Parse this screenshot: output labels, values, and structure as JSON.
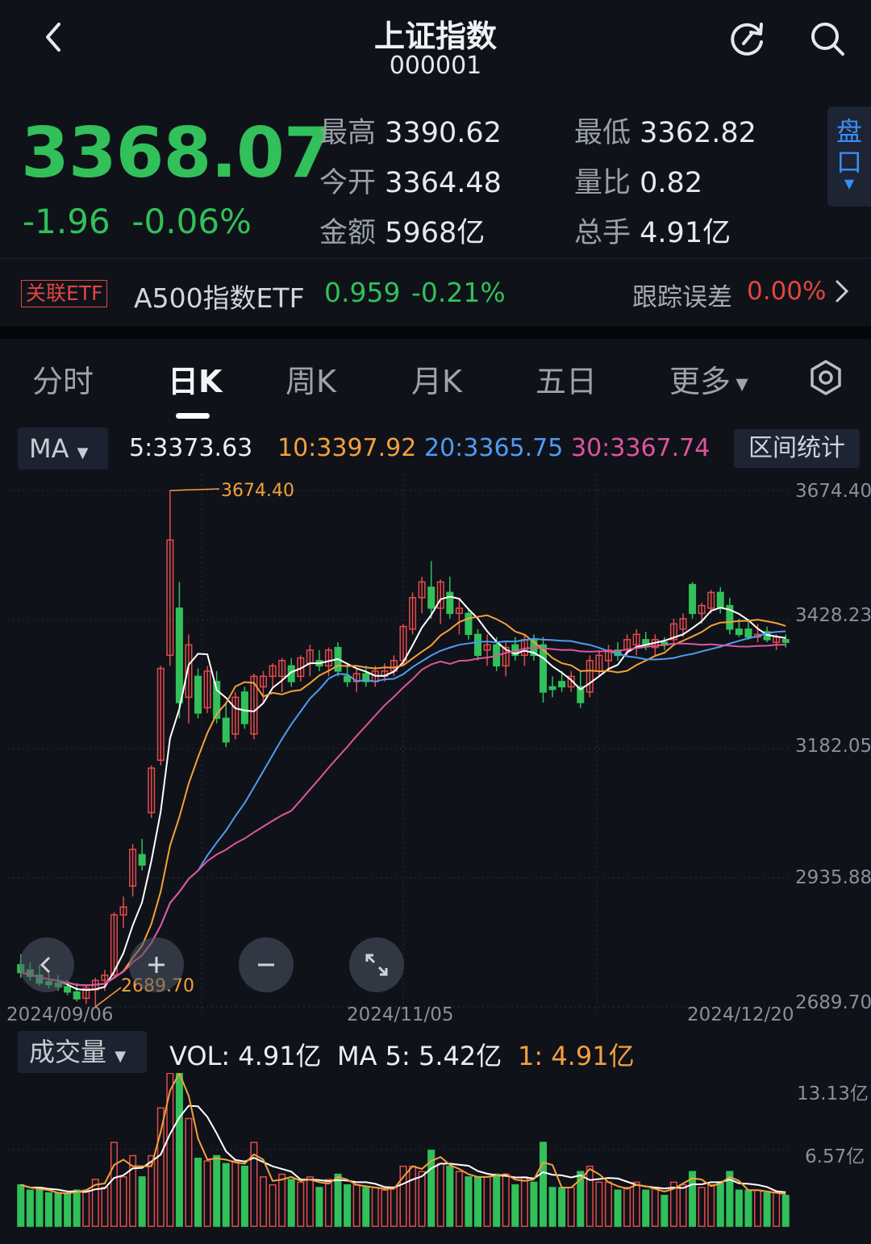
{
  "header": {
    "title": "上证指数",
    "code": "000001"
  },
  "quote": {
    "price": "3368.07",
    "change": "-1.96",
    "change_pct": "-0.06%",
    "high_label": "最高",
    "high": "3390.62",
    "low_label": "最低",
    "low": "3362.82",
    "open_label": "今开",
    "open": "3364.48",
    "vol_ratio_label": "量比",
    "vol_ratio": "0.82",
    "amount_label": "金额",
    "amount": "5968亿",
    "turnover_label": "总手",
    "turnover": "4.91亿",
    "pankou_label": "盘口"
  },
  "etf": {
    "tag": "关联ETF",
    "name": "A500指数ETF",
    "price": "0.959",
    "change_pct": "-0.21%",
    "tracking_label": "跟踪误差",
    "tracking_value": "0.00%"
  },
  "tabs": [
    "分时",
    "日K",
    "周K",
    "月K",
    "五日",
    "更多"
  ],
  "active_tab": 1,
  "ma_bar": {
    "selector": "MA",
    "ma5": "5:3373.63",
    "ma10": "10:3397.92",
    "ma20": "20:3365.75",
    "ma30": "30:3367.74",
    "range_button": "区间统计"
  },
  "price_axis": [
    "3674.40",
    "3428.23",
    "3182.05",
    "2935.88",
    "2689.70"
  ],
  "date_axis": [
    "2024/09/06",
    "2024/11/05",
    "2024/12/20"
  ],
  "annotations": {
    "max": "3674.40",
    "min": "2689.70"
  },
  "volume_bar": {
    "selector": "成交量",
    "vol": "VOL: 4.91亿",
    "ma5": "MA 5: 5.42亿",
    "ma1": "1: 4.91亿"
  },
  "volume_axis": [
    "13.13亿",
    "6.57亿"
  ],
  "colors": {
    "up": "#e54b4b",
    "down": "#31c05a",
    "ma5": "#ffffff",
    "ma10": "#f5a03c",
    "ma20": "#4f9cf2",
    "ma30": "#e0549e",
    "accent": "#3b8cf6"
  },
  "chart_data": {
    "type": "candlestick",
    "ylim": [
      2689.7,
      3674.4
    ],
    "candles": [
      {
        "o": 2770,
        "h": 2790,
        "l": 2745,
        "c": 2755
      },
      {
        "o": 2760,
        "h": 2775,
        "l": 2740,
        "c": 2748
      },
      {
        "o": 2750,
        "h": 2770,
        "l": 2730,
        "c": 2735
      },
      {
        "o": 2738,
        "h": 2755,
        "l": 2725,
        "c": 2732
      },
      {
        "o": 2735,
        "h": 2750,
        "l": 2720,
        "c": 2728
      },
      {
        "o": 2728,
        "h": 2740,
        "l": 2712,
        "c": 2718
      },
      {
        "o": 2718,
        "h": 2735,
        "l": 2700,
        "c": 2705
      },
      {
        "o": 2706,
        "h": 2730,
        "l": 2695,
        "c": 2725
      },
      {
        "o": 2722,
        "h": 2745,
        "l": 2689.7,
        "c": 2740
      },
      {
        "o": 2740,
        "h": 2760,
        "l": 2720,
        "c": 2750
      },
      {
        "o": 2750,
        "h": 2870,
        "l": 2745,
        "c": 2865
      },
      {
        "o": 2865,
        "h": 2900,
        "l": 2840,
        "c": 2880
      },
      {
        "o": 2920,
        "h": 3000,
        "l": 2900,
        "c": 2990
      },
      {
        "o": 2980,
        "h": 3010,
        "l": 2950,
        "c": 2960
      },
      {
        "o": 3060,
        "h": 3150,
        "l": 3050,
        "c": 3145
      },
      {
        "o": 3160,
        "h": 3340,
        "l": 3150,
        "c": 3335
      },
      {
        "o": 3360,
        "h": 3674.4,
        "l": 3340,
        "c": 3580
      },
      {
        "o": 3450,
        "h": 3500,
        "l": 3240,
        "c": 3270
      },
      {
        "o": 3280,
        "h": 3400,
        "l": 3230,
        "c": 3380
      },
      {
        "o": 3320,
        "h": 3335,
        "l": 3240,
        "c": 3250
      },
      {
        "o": 3260,
        "h": 3340,
        "l": 3250,
        "c": 3330
      },
      {
        "o": 3310,
        "h": 3330,
        "l": 3230,
        "c": 3240
      },
      {
        "o": 3240,
        "h": 3270,
        "l": 3185,
        "c": 3195
      },
      {
        "o": 3210,
        "h": 3290,
        "l": 3200,
        "c": 3280
      },
      {
        "o": 3290,
        "h": 3300,
        "l": 3220,
        "c": 3230
      },
      {
        "o": 3210,
        "h": 3325,
        "l": 3200,
        "c": 3320
      },
      {
        "o": 3300,
        "h": 3330,
        "l": 3270,
        "c": 3320
      },
      {
        "o": 3320,
        "h": 3345,
        "l": 3300,
        "c": 3340
      },
      {
        "o": 3320,
        "h": 3355,
        "l": 3290,
        "c": 3350
      },
      {
        "o": 3340,
        "h": 3355,
        "l": 3300,
        "c": 3310
      },
      {
        "o": 3320,
        "h": 3360,
        "l": 3310,
        "c": 3355
      },
      {
        "o": 3345,
        "h": 3380,
        "l": 3320,
        "c": 3370
      },
      {
        "o": 3350,
        "h": 3370,
        "l": 3330,
        "c": 3340
      },
      {
        "o": 3340,
        "h": 3375,
        "l": 3320,
        "c": 3370
      },
      {
        "o": 3375,
        "h": 3385,
        "l": 3320,
        "c": 3330
      },
      {
        "o": 3320,
        "h": 3345,
        "l": 3300,
        "c": 3310
      },
      {
        "o": 3310,
        "h": 3335,
        "l": 3290,
        "c": 3325
      },
      {
        "o": 3325,
        "h": 3340,
        "l": 3300,
        "c": 3310
      },
      {
        "o": 3310,
        "h": 3340,
        "l": 3300,
        "c": 3330
      },
      {
        "o": 3320,
        "h": 3345,
        "l": 3310,
        "c": 3330
      },
      {
        "o": 3330,
        "h": 3360,
        "l": 3320,
        "c": 3350
      },
      {
        "o": 3350,
        "h": 3420,
        "l": 3340,
        "c": 3415
      },
      {
        "o": 3410,
        "h": 3480,
        "l": 3400,
        "c": 3470
      },
      {
        "o": 3470,
        "h": 3510,
        "l": 3440,
        "c": 3500
      },
      {
        "o": 3490,
        "h": 3540,
        "l": 3430,
        "c": 3450
      },
      {
        "o": 3450,
        "h": 3505,
        "l": 3420,
        "c": 3500
      },
      {
        "o": 3480,
        "h": 3510,
        "l": 3430,
        "c": 3440
      },
      {
        "o": 3440,
        "h": 3470,
        "l": 3400,
        "c": 3450
      },
      {
        "o": 3440,
        "h": 3450,
        "l": 3390,
        "c": 3400
      },
      {
        "o": 3400,
        "h": 3410,
        "l": 3350,
        "c": 3360
      },
      {
        "o": 3370,
        "h": 3400,
        "l": 3340,
        "c": 3380
      },
      {
        "o": 3380,
        "h": 3395,
        "l": 3330,
        "c": 3340
      },
      {
        "o": 3340,
        "h": 3385,
        "l": 3320,
        "c": 3375
      },
      {
        "o": 3380,
        "h": 3395,
        "l": 3350,
        "c": 3360
      },
      {
        "o": 3360,
        "h": 3400,
        "l": 3340,
        "c": 3390
      },
      {
        "o": 3390,
        "h": 3400,
        "l": 3350,
        "c": 3360
      },
      {
        "o": 3380,
        "h": 3395,
        "l": 3270,
        "c": 3290
      },
      {
        "o": 3300,
        "h": 3320,
        "l": 3280,
        "c": 3295
      },
      {
        "o": 3310,
        "h": 3330,
        "l": 3290,
        "c": 3300
      },
      {
        "o": 3300,
        "h": 3330,
        "l": 3290,
        "c": 3320
      },
      {
        "o": 3300,
        "h": 3330,
        "l": 3260,
        "c": 3270
      },
      {
        "o": 3290,
        "h": 3360,
        "l": 3280,
        "c": 3350
      },
      {
        "o": 3330,
        "h": 3370,
        "l": 3320,
        "c": 3360
      },
      {
        "o": 3350,
        "h": 3380,
        "l": 3330,
        "c": 3370
      },
      {
        "o": 3370,
        "h": 3385,
        "l": 3350,
        "c": 3360
      },
      {
        "o": 3370,
        "h": 3400,
        "l": 3360,
        "c": 3390
      },
      {
        "o": 3380,
        "h": 3410,
        "l": 3360,
        "c": 3400
      },
      {
        "o": 3390,
        "h": 3405,
        "l": 3370,
        "c": 3380
      },
      {
        "o": 3375,
        "h": 3400,
        "l": 3360,
        "c": 3390
      },
      {
        "o": 3385,
        "h": 3395,
        "l": 3370,
        "c": 3380
      },
      {
        "o": 3390,
        "h": 3430,
        "l": 3380,
        "c": 3420
      },
      {
        "o": 3410,
        "h": 3440,
        "l": 3395,
        "c": 3430
      },
      {
        "o": 3495,
        "h": 3500,
        "l": 3430,
        "c": 3440
      },
      {
        "o": 3440,
        "h": 3460,
        "l": 3420,
        "c": 3455
      },
      {
        "o": 3450,
        "h": 3485,
        "l": 3440,
        "c": 3480
      },
      {
        "o": 3480,
        "h": 3490,
        "l": 3440,
        "c": 3450
      },
      {
        "o": 3455,
        "h": 3470,
        "l": 3400,
        "c": 3410
      },
      {
        "o": 3410,
        "h": 3430,
        "l": 3395,
        "c": 3400
      },
      {
        "o": 3410,
        "h": 3425,
        "l": 3390,
        "c": 3395
      },
      {
        "o": 3395,
        "h": 3420,
        "l": 3385,
        "c": 3400
      },
      {
        "o": 3405,
        "h": 3415,
        "l": 3385,
        "c": 3390
      },
      {
        "o": 3385,
        "h": 3400,
        "l": 3370,
        "c": 3395
      },
      {
        "o": 3390,
        "h": 3400,
        "l": 3375,
        "c": 3385
      }
    ],
    "volume_ylim": [
      0,
      13.13
    ],
    "volume_unit": "亿"
  }
}
